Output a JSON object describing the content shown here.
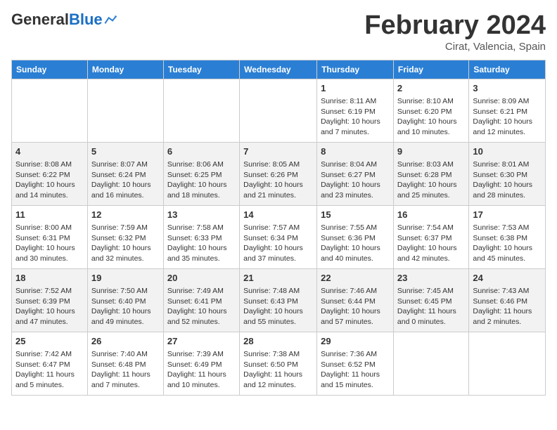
{
  "header": {
    "logo_general": "General",
    "logo_blue": "Blue",
    "month_title": "February 2024",
    "location": "Cirat, Valencia, Spain"
  },
  "days_of_week": [
    "Sunday",
    "Monday",
    "Tuesday",
    "Wednesday",
    "Thursday",
    "Friday",
    "Saturday"
  ],
  "weeks": [
    [
      {
        "day": "",
        "empty": true
      },
      {
        "day": "",
        "empty": true
      },
      {
        "day": "",
        "empty": true
      },
      {
        "day": "",
        "empty": true
      },
      {
        "day": "1",
        "sunrise": "Sunrise: 8:11 AM",
        "sunset": "Sunset: 6:19 PM",
        "daylight": "Daylight: 10 hours and 7 minutes."
      },
      {
        "day": "2",
        "sunrise": "Sunrise: 8:10 AM",
        "sunset": "Sunset: 6:20 PM",
        "daylight": "Daylight: 10 hours and 10 minutes."
      },
      {
        "day": "3",
        "sunrise": "Sunrise: 8:09 AM",
        "sunset": "Sunset: 6:21 PM",
        "daylight": "Daylight: 10 hours and 12 minutes."
      }
    ],
    [
      {
        "day": "4",
        "sunrise": "Sunrise: 8:08 AM",
        "sunset": "Sunset: 6:22 PM",
        "daylight": "Daylight: 10 hours and 14 minutes."
      },
      {
        "day": "5",
        "sunrise": "Sunrise: 8:07 AM",
        "sunset": "Sunset: 6:24 PM",
        "daylight": "Daylight: 10 hours and 16 minutes."
      },
      {
        "day": "6",
        "sunrise": "Sunrise: 8:06 AM",
        "sunset": "Sunset: 6:25 PM",
        "daylight": "Daylight: 10 hours and 18 minutes."
      },
      {
        "day": "7",
        "sunrise": "Sunrise: 8:05 AM",
        "sunset": "Sunset: 6:26 PM",
        "daylight": "Daylight: 10 hours and 21 minutes."
      },
      {
        "day": "8",
        "sunrise": "Sunrise: 8:04 AM",
        "sunset": "Sunset: 6:27 PM",
        "daylight": "Daylight: 10 hours and 23 minutes."
      },
      {
        "day": "9",
        "sunrise": "Sunrise: 8:03 AM",
        "sunset": "Sunset: 6:28 PM",
        "daylight": "Daylight: 10 hours and 25 minutes."
      },
      {
        "day": "10",
        "sunrise": "Sunrise: 8:01 AM",
        "sunset": "Sunset: 6:30 PM",
        "daylight": "Daylight: 10 hours and 28 minutes."
      }
    ],
    [
      {
        "day": "11",
        "sunrise": "Sunrise: 8:00 AM",
        "sunset": "Sunset: 6:31 PM",
        "daylight": "Daylight: 10 hours and 30 minutes."
      },
      {
        "day": "12",
        "sunrise": "Sunrise: 7:59 AM",
        "sunset": "Sunset: 6:32 PM",
        "daylight": "Daylight: 10 hours and 32 minutes."
      },
      {
        "day": "13",
        "sunrise": "Sunrise: 7:58 AM",
        "sunset": "Sunset: 6:33 PM",
        "daylight": "Daylight: 10 hours and 35 minutes."
      },
      {
        "day": "14",
        "sunrise": "Sunrise: 7:57 AM",
        "sunset": "Sunset: 6:34 PM",
        "daylight": "Daylight: 10 hours and 37 minutes."
      },
      {
        "day": "15",
        "sunrise": "Sunrise: 7:55 AM",
        "sunset": "Sunset: 6:36 PM",
        "daylight": "Daylight: 10 hours and 40 minutes."
      },
      {
        "day": "16",
        "sunrise": "Sunrise: 7:54 AM",
        "sunset": "Sunset: 6:37 PM",
        "daylight": "Daylight: 10 hours and 42 minutes."
      },
      {
        "day": "17",
        "sunrise": "Sunrise: 7:53 AM",
        "sunset": "Sunset: 6:38 PM",
        "daylight": "Daylight: 10 hours and 45 minutes."
      }
    ],
    [
      {
        "day": "18",
        "sunrise": "Sunrise: 7:52 AM",
        "sunset": "Sunset: 6:39 PM",
        "daylight": "Daylight: 10 hours and 47 minutes."
      },
      {
        "day": "19",
        "sunrise": "Sunrise: 7:50 AM",
        "sunset": "Sunset: 6:40 PM",
        "daylight": "Daylight: 10 hours and 49 minutes."
      },
      {
        "day": "20",
        "sunrise": "Sunrise: 7:49 AM",
        "sunset": "Sunset: 6:41 PM",
        "daylight": "Daylight: 10 hours and 52 minutes."
      },
      {
        "day": "21",
        "sunrise": "Sunrise: 7:48 AM",
        "sunset": "Sunset: 6:43 PM",
        "daylight": "Daylight: 10 hours and 55 minutes."
      },
      {
        "day": "22",
        "sunrise": "Sunrise: 7:46 AM",
        "sunset": "Sunset: 6:44 PM",
        "daylight": "Daylight: 10 hours and 57 minutes."
      },
      {
        "day": "23",
        "sunrise": "Sunrise: 7:45 AM",
        "sunset": "Sunset: 6:45 PM",
        "daylight": "Daylight: 11 hours and 0 minutes."
      },
      {
        "day": "24",
        "sunrise": "Sunrise: 7:43 AM",
        "sunset": "Sunset: 6:46 PM",
        "daylight": "Daylight: 11 hours and 2 minutes."
      }
    ],
    [
      {
        "day": "25",
        "sunrise": "Sunrise: 7:42 AM",
        "sunset": "Sunset: 6:47 PM",
        "daylight": "Daylight: 11 hours and 5 minutes."
      },
      {
        "day": "26",
        "sunrise": "Sunrise: 7:40 AM",
        "sunset": "Sunset: 6:48 PM",
        "daylight": "Daylight: 11 hours and 7 minutes."
      },
      {
        "day": "27",
        "sunrise": "Sunrise: 7:39 AM",
        "sunset": "Sunset: 6:49 PM",
        "daylight": "Daylight: 11 hours and 10 minutes."
      },
      {
        "day": "28",
        "sunrise": "Sunrise: 7:38 AM",
        "sunset": "Sunset: 6:50 PM",
        "daylight": "Daylight: 11 hours and 12 minutes."
      },
      {
        "day": "29",
        "sunrise": "Sunrise: 7:36 AM",
        "sunset": "Sunset: 6:52 PM",
        "daylight": "Daylight: 11 hours and 15 minutes."
      },
      {
        "day": "",
        "empty": true
      },
      {
        "day": "",
        "empty": true
      }
    ]
  ]
}
